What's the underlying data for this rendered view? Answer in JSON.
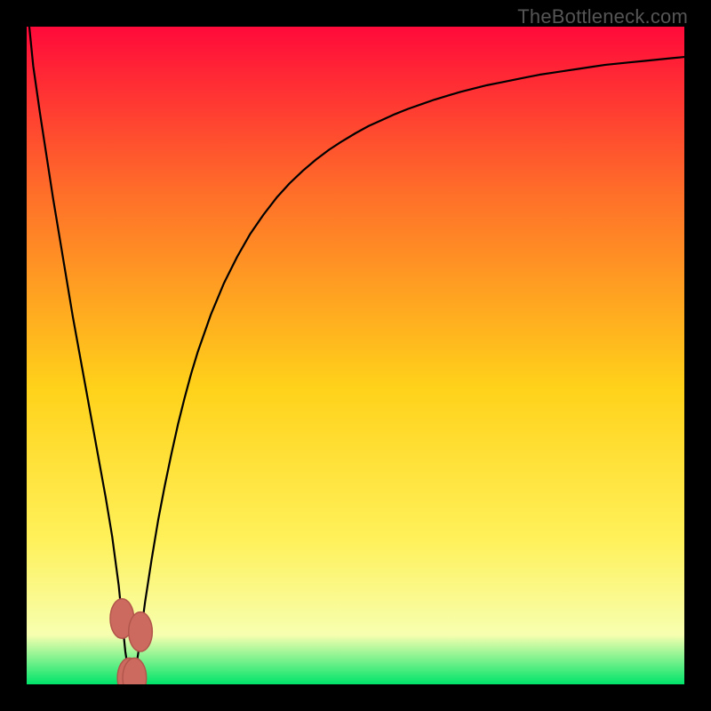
{
  "watermark": "TheBottleneck.com",
  "colors": {
    "frame": "#000000",
    "grad_top": "#ff0a3a",
    "grad_mid1": "#ff6a2a",
    "grad_mid2": "#ffd21a",
    "grad_mid3": "#fff15a",
    "grad_low": "#f7ffb0",
    "grad_bottom": "#00e46a",
    "curve": "#000000",
    "marker_fill": "#cc6a5f",
    "marker_stroke": "#b2564c"
  },
  "chart_data": {
    "type": "line",
    "title": "",
    "xlabel": "",
    "ylabel": "",
    "xlim": [
      0,
      100
    ],
    "ylim": [
      0,
      100
    ],
    "x": [
      0.4,
      1,
      2,
      3,
      4,
      5,
      6,
      7,
      8,
      9,
      10,
      11,
      12,
      13,
      14,
      14.5,
      15,
      15.6,
      16.4,
      17,
      18,
      19,
      20,
      21,
      22,
      23,
      24,
      25,
      26,
      28,
      30,
      32,
      34,
      36,
      38,
      40,
      42,
      44,
      46,
      48,
      50,
      52,
      54,
      56,
      58,
      60,
      62,
      64,
      66,
      68,
      70,
      72,
      74,
      76,
      78,
      80,
      82,
      84,
      86,
      88,
      90,
      92,
      94,
      96,
      98,
      100
    ],
    "values": [
      100,
      94,
      87,
      80.5,
      74,
      68,
      62,
      56,
      50.5,
      45,
      39.5,
      34,
      28.5,
      22.5,
      15,
      10,
      5,
      1,
      1,
      5,
      12.5,
      19,
      25,
      30.2,
      35,
      39.5,
      43.5,
      47.2,
      50.5,
      56.2,
      61,
      65,
      68.5,
      71.4,
      74,
      76.2,
      78.1,
      79.8,
      81.3,
      82.6,
      83.8,
      84.9,
      85.8,
      86.7,
      87.5,
      88.2,
      88.9,
      89.5,
      90.1,
      90.6,
      91.1,
      91.5,
      91.9,
      92.3,
      92.7,
      93,
      93.3,
      93.6,
      93.9,
      94.2,
      94.4,
      94.6,
      94.8,
      95,
      95.2,
      95.4
    ],
    "markers": [
      {
        "x": 14.5,
        "y": 10,
        "rx": 1.8,
        "ry": 3.0
      },
      {
        "x": 15.6,
        "y": 1,
        "rx": 1.8,
        "ry": 3.0
      },
      {
        "x": 16.4,
        "y": 1,
        "rx": 1.8,
        "ry": 3.0
      },
      {
        "x": 17.3,
        "y": 8,
        "rx": 1.8,
        "ry": 3.0
      }
    ],
    "minimum_x": 16
  }
}
